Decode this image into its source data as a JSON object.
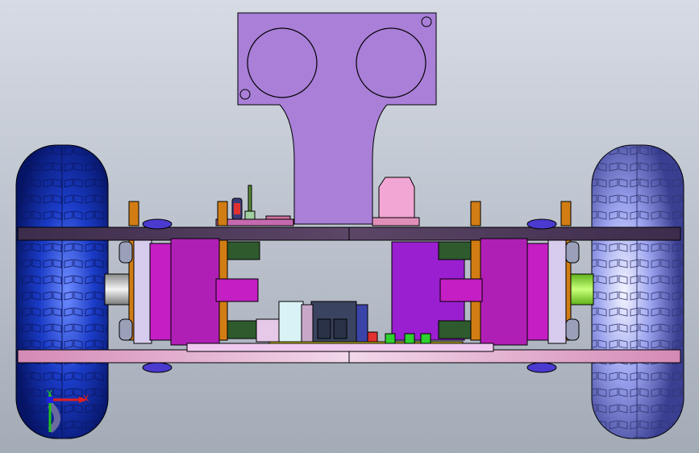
{
  "viewport": {
    "background_top": "#d6dbe4",
    "background_bottom": "#a3abb7"
  },
  "colors": {
    "bracket": "#a97fd8",
    "chassis_plate_top": "#4a3a55",
    "chassis_plate_bottom": "#e8c1dc",
    "motor_magenta": "#c41ec4",
    "motor_block": "#9a1fd0",
    "wheel_left": "#1a3cc8",
    "wheel_right": "#8e96e6",
    "standoff": "#d27d14",
    "shaft_green": "#9ef03c",
    "board_yellow": "#f2e11a"
  },
  "icons": {
    "triad": "xyz-triad-icon",
    "hole": "mounting-hole-icon"
  },
  "triad": {
    "x_label": "X",
    "y_label": "Y"
  }
}
